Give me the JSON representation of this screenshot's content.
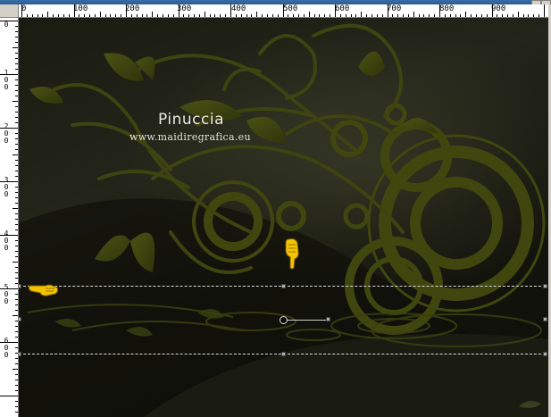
{
  "ruler": {
    "top_labels": [
      "0",
      "100",
      "200",
      "300",
      "400",
      "500",
      "600",
      "700",
      "800",
      "900"
    ],
    "left_labels": [
      "0",
      "100",
      "200",
      "300",
      "400",
      "500",
      "600"
    ]
  },
  "watermark": {
    "title": "Pinuccia",
    "url": "www.maidiregrafica.eu"
  },
  "colors": {
    "canvas_dark": "#1a1c12",
    "ornament_green": "#3d4410",
    "ornament_light": "#5a6418",
    "pointer_yellow": "#f5c400",
    "selection_line": "#d8d8d8"
  },
  "icons": {
    "left_pointer": "pointing-hand-right-icon",
    "down_pointer": "pointing-hand-down-icon"
  }
}
